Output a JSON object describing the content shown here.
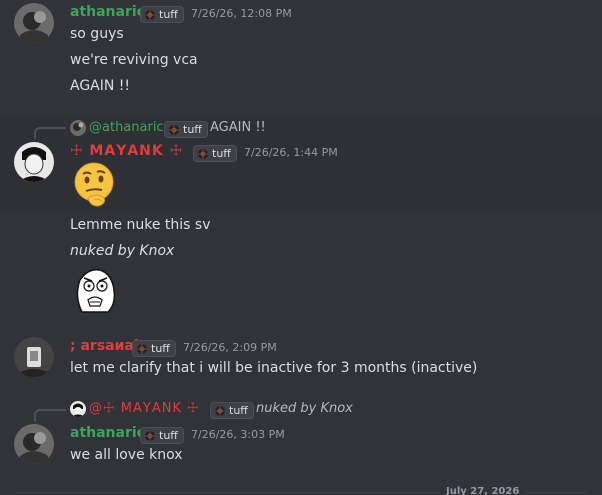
{
  "colors": {
    "bg": "#313338",
    "highlight": "#2e3035",
    "athanaric": "#3ba55c",
    "maya": "#e23b3b",
    "arsanal": "#e23b3b",
    "timestamp": "#949ba4"
  },
  "messages": [
    {
      "author": "athanaric",
      "tag": "tuff",
      "timestamp": "7/26/26, 12:08 PM",
      "lines": [
        "so guys",
        "we're reviving vca",
        "AGAIN !!"
      ]
    },
    {
      "reply": {
        "mention": "@athanaric",
        "tag": "tuff",
        "text": "AGAIN !!"
      },
      "author": "☩ ΜΑΥΑΝΚ ☩",
      "tag": "tuff",
      "timestamp": "7/26/26, 1:44 PM",
      "emoji": "thinking-emoji"
    },
    {
      "lines": [
        "Lemme nuke this sv",
        "nuked by Knox"
      ],
      "emoji": "rage-face-sticker"
    },
    {
      "author": "; arsaиal",
      "tag": "tuff",
      "timestamp": "7/26/26, 2:09 PM",
      "lines": [
        "let me clarify that i will be inactive for 3 months (inactive)"
      ]
    },
    {
      "reply": {
        "mention": "@☩ ΜΑΥΑΝΚ ☩",
        "tag": "tuff",
        "text": "nuked by Knox"
      },
      "author": "athanaric",
      "tag": "tuff",
      "timestamp": "7/26/26, 3:03 PM",
      "lines": [
        "we all love knox"
      ]
    }
  ],
  "date_divider": "July 27, 2026"
}
